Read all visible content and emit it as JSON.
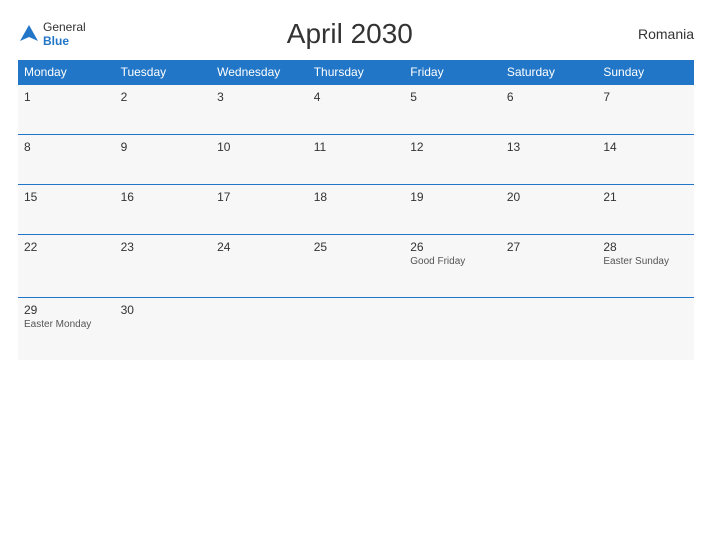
{
  "header": {
    "logo": {
      "general": "General",
      "blue": "Blue",
      "flag_shape": "triangle"
    },
    "title": "April 2030",
    "country": "Romania"
  },
  "weekdays": [
    "Monday",
    "Tuesday",
    "Wednesday",
    "Thursday",
    "Friday",
    "Saturday",
    "Sunday"
  ],
  "weeks": [
    [
      {
        "day": "1",
        "event": ""
      },
      {
        "day": "2",
        "event": ""
      },
      {
        "day": "3",
        "event": ""
      },
      {
        "day": "4",
        "event": ""
      },
      {
        "day": "5",
        "event": ""
      },
      {
        "day": "6",
        "event": ""
      },
      {
        "day": "7",
        "event": ""
      }
    ],
    [
      {
        "day": "8",
        "event": ""
      },
      {
        "day": "9",
        "event": ""
      },
      {
        "day": "10",
        "event": ""
      },
      {
        "day": "11",
        "event": ""
      },
      {
        "day": "12",
        "event": ""
      },
      {
        "day": "13",
        "event": ""
      },
      {
        "day": "14",
        "event": ""
      }
    ],
    [
      {
        "day": "15",
        "event": ""
      },
      {
        "day": "16",
        "event": ""
      },
      {
        "day": "17",
        "event": ""
      },
      {
        "day": "18",
        "event": ""
      },
      {
        "day": "19",
        "event": ""
      },
      {
        "day": "20",
        "event": ""
      },
      {
        "day": "21",
        "event": ""
      }
    ],
    [
      {
        "day": "22",
        "event": ""
      },
      {
        "day": "23",
        "event": ""
      },
      {
        "day": "24",
        "event": ""
      },
      {
        "day": "25",
        "event": ""
      },
      {
        "day": "26",
        "event": "Good Friday"
      },
      {
        "day": "27",
        "event": ""
      },
      {
        "day": "28",
        "event": "Easter Sunday"
      }
    ],
    [
      {
        "day": "29",
        "event": "Easter Monday"
      },
      {
        "day": "30",
        "event": ""
      },
      {
        "day": "",
        "event": ""
      },
      {
        "day": "",
        "event": ""
      },
      {
        "day": "",
        "event": ""
      },
      {
        "day": "",
        "event": ""
      },
      {
        "day": "",
        "event": ""
      }
    ]
  ],
  "colors": {
    "header_bg": "#2176c7",
    "header_text": "#ffffff",
    "body_bg": "#f7f7f7",
    "text": "#333333",
    "event_text": "#555555"
  }
}
